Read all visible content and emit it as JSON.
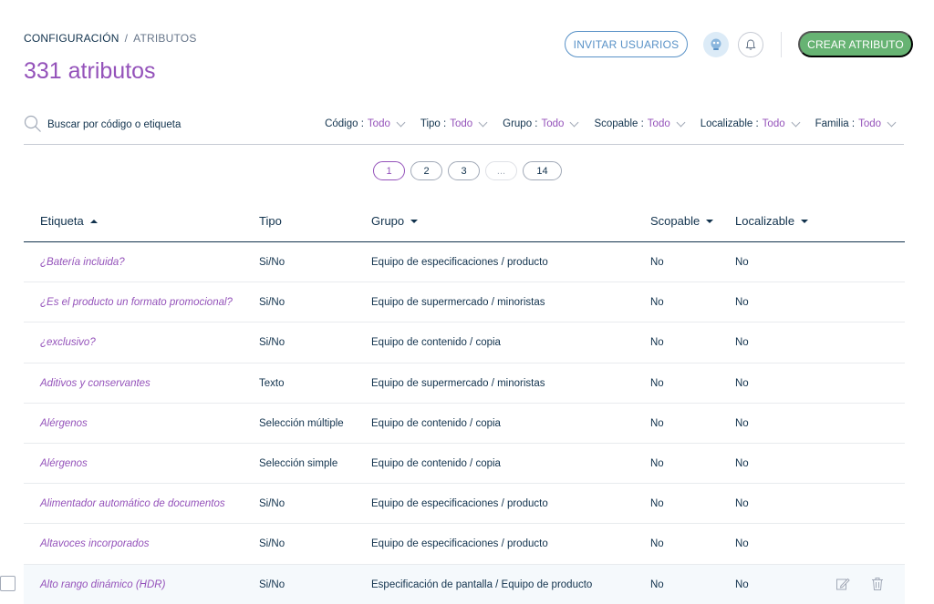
{
  "breadcrumb": {
    "parent": "CONFIGURACIÓN",
    "separator": "/",
    "current": "ATRIBUTOS"
  },
  "page_title": "331 atributos",
  "header": {
    "invite_label": "INVITAR USUARIOS",
    "create_label": "CREAR ATRIBUTO",
    "help_icon": "help-icon",
    "bell_icon": "bell-icon"
  },
  "search": {
    "placeholder": "Buscar por código o etiqueta",
    "value": ""
  },
  "filters": [
    {
      "name": "Código",
      "sep": " :",
      "value": "Todo"
    },
    {
      "name": "Tipo",
      "sep": " :",
      "value": "Todo"
    },
    {
      "name": "Grupo",
      "sep": " :",
      "value": "Todo"
    },
    {
      "name": "Scopable",
      "sep": " :",
      "value": "Todo"
    },
    {
      "name": "Localizable",
      "sep": " :",
      "value": "Todo"
    },
    {
      "name": "Familia",
      "sep": " :",
      "value": "Todo"
    }
  ],
  "pagination": [
    "1",
    "2",
    "3",
    "...",
    "14"
  ],
  "columns": {
    "label": "Etiqueta",
    "type": "Tipo",
    "group": "Grupo",
    "scopable": "Scopable",
    "localizable": "Localizable"
  },
  "rows": [
    {
      "label": "¿Batería incluida?",
      "type": "Si/No",
      "group": "Equipo de especificaciones / producto",
      "scopable": "No",
      "localizable": "No"
    },
    {
      "label": "¿Es el producto un formato promocional?",
      "type": "Si/No",
      "group": "Equipo de supermercado / minoristas",
      "scopable": "No",
      "localizable": "No"
    },
    {
      "label": "¿exclusivo?",
      "type": "Si/No",
      "group": "Equipo de contenido / copia",
      "scopable": "No",
      "localizable": "No"
    },
    {
      "label": "Aditivos y conservantes",
      "type": "Texto",
      "group": "Equipo de supermercado / minoristas",
      "scopable": "No",
      "localizable": "No"
    },
    {
      "label": "Alérgenos",
      "type": "Selección múltiple",
      "group": "Equipo de contenido / copia",
      "scopable": "No",
      "localizable": "No"
    },
    {
      "label": "Alérgenos",
      "type": "Selección simple",
      "group": "Equipo de contenido / copia",
      "scopable": "No",
      "localizable": "No"
    },
    {
      "label": "Alimentador automático de documentos",
      "type": "Si/No",
      "group": "Equipo de especificaciones / producto",
      "scopable": "No",
      "localizable": "No"
    },
    {
      "label": "Altavoces incorporados",
      "type": "Si/No",
      "group": "Equipo de especificaciones / producto",
      "scopable": "No",
      "localizable": "No"
    },
    {
      "label": "Alto rango dinámico (HDR)",
      "type": "Si/No",
      "group": "Especificación de pantalla / Equipo de producto",
      "scopable": "No",
      "localizable": "No"
    }
  ],
  "colors": {
    "accent": "#9452ba",
    "primary_text": "#11324d",
    "create_button": "#67b373",
    "invite_button": "#5992c7"
  }
}
